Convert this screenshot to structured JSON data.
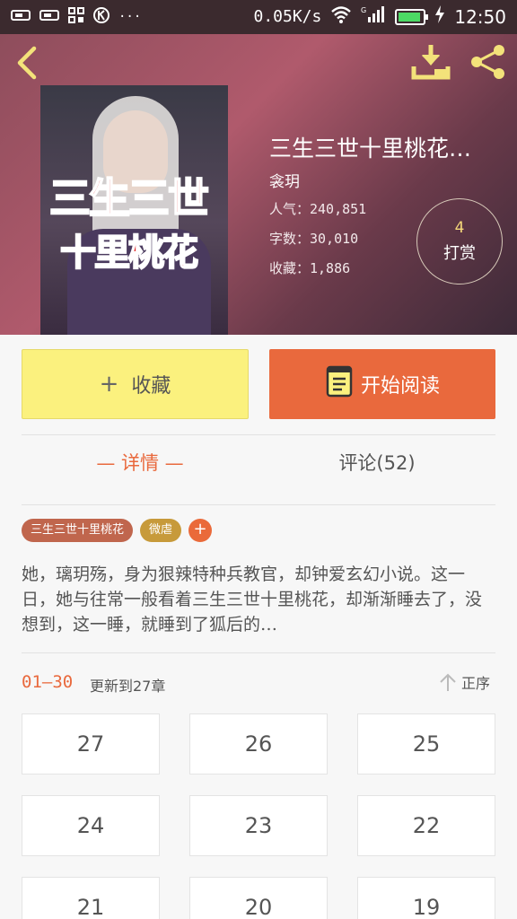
{
  "status_bar": {
    "net_speed": "0.05K/s",
    "signal_label": "G",
    "time": "12:50",
    "battery_level": 0.9
  },
  "book": {
    "title": "三生三世十里桃花…",
    "author": "衾玥",
    "popularity": "人气：240,851",
    "word_count": "字数：30,010",
    "favorites": "收藏：1,886",
    "cover_art_title_line1": "三生三世",
    "cover_art_title_line2": "十里桃花",
    "reward_count": "4",
    "reward_label": "打赏"
  },
  "actions": {
    "favorite_label": "收藏",
    "favorite_plus": "+",
    "read_label": "开始阅读"
  },
  "tabs": {
    "detail": "— 详情 —",
    "comments": "评论(52)"
  },
  "tags": [
    "三生三世十里桃花",
    "微虐"
  ],
  "tag_add": "+",
  "intro": "她，璃玥殇，身为狠辣特种兵教官，却钟爱玄幻小说。这一日，她与往常一般看着三生三世十里桃花，却渐渐睡去了，没想到，这一睡，就睡到了狐后的…",
  "chapter_list": {
    "range": "01—30",
    "update_text": "更新到27章",
    "sort_label": "正序",
    "chapters": [
      "27",
      "26",
      "25",
      "24",
      "23",
      "22",
      "21",
      "20",
      "19"
    ]
  },
  "colors": {
    "accent": "#e9693d",
    "favorite_button": "#fbf17e",
    "tag_novel": "#c0664d",
    "tag_genre": "#c79a3a"
  },
  "icons": [
    "back-icon",
    "download-icon",
    "share-icon",
    "wifi-icon",
    "signal-icon",
    "battery-icon",
    "book-icon",
    "sort-up-icon"
  ]
}
